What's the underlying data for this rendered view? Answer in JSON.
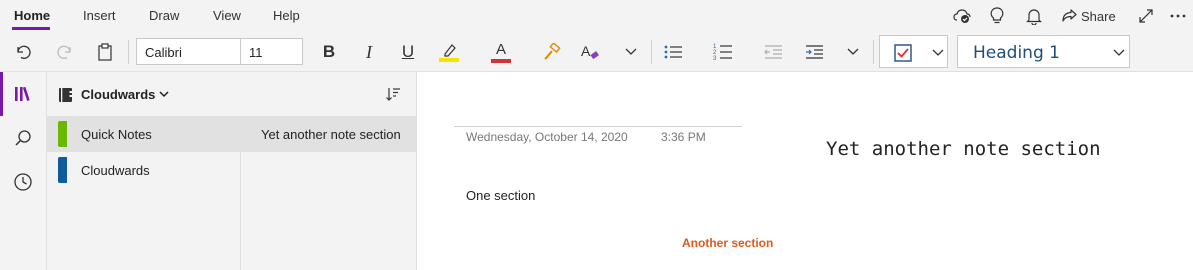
{
  "ribbon": {
    "tabs": [
      {
        "label": "Home"
      },
      {
        "label": "Insert"
      },
      {
        "label": "Draw"
      },
      {
        "label": "View"
      },
      {
        "label": "Help"
      }
    ],
    "share_label": "Share"
  },
  "toolbar": {
    "font_name": "Calibri",
    "font_size": "11",
    "style_label": "Heading 1",
    "colors": {
      "highlight": "#f2e600",
      "font_color": "#d13438",
      "todo_check": "#d13438",
      "todo_border": "#1f4e79",
      "accent": "#7719aa"
    }
  },
  "notebook": {
    "name": "Cloudwards",
    "sections": [
      {
        "label": "Quick Notes",
        "color": "#6bb700"
      },
      {
        "label": "Cloudwards",
        "color": "#0e5c9e"
      }
    ],
    "pages": [
      {
        "label": "Yet another note section"
      }
    ]
  },
  "page": {
    "date": "Wednesday, October 14, 2020",
    "time": "3:36 PM",
    "title": "Yet another note section",
    "body_text": "One section",
    "orange_text": "Another section"
  }
}
